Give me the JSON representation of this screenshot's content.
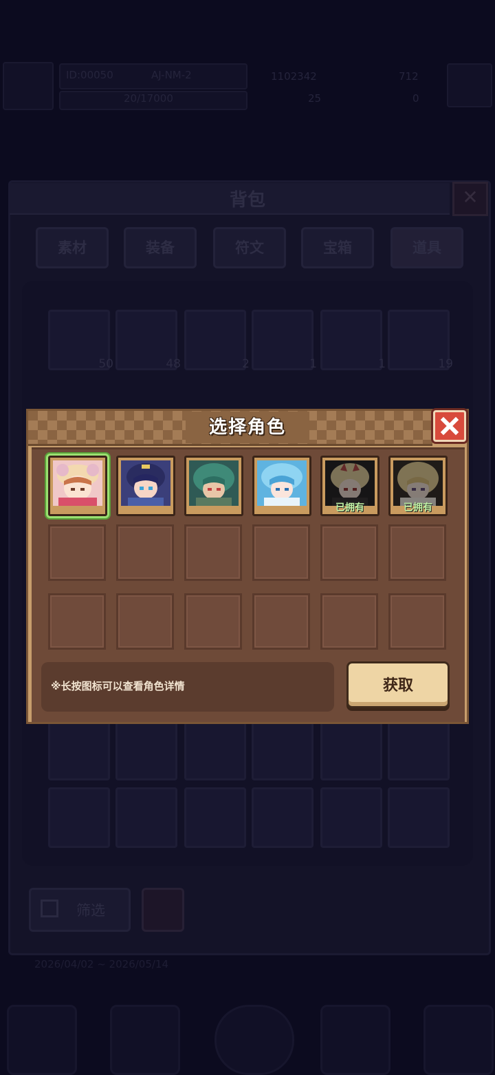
{
  "background": {
    "topbar": {
      "player_id_label": "ID:00050",
      "version_label": "AJ-NM-2",
      "gold_value": "1102342",
      "gem_value": "712",
      "stamina_value": "20/17000",
      "key_value": "25",
      "ticket_value": "0"
    },
    "bag_title": "背包",
    "tabs": [
      "素材",
      "装备",
      "符文",
      "宝箱",
      "道具"
    ],
    "item_counts": [
      "50",
      "48",
      "2",
      "1",
      "1",
      "19"
    ],
    "filter_label": "筛选",
    "date_range": "2026/04/02 ~ 2026/05/14"
  },
  "modal": {
    "title": "选择角色",
    "close_icon": "close-icon",
    "characters": [
      {
        "name": "character-1",
        "owned": false,
        "selected": true,
        "owned_label": ""
      },
      {
        "name": "character-2",
        "owned": false,
        "selected": false,
        "owned_label": ""
      },
      {
        "name": "character-3",
        "owned": false,
        "selected": false,
        "owned_label": ""
      },
      {
        "name": "character-4",
        "owned": false,
        "selected": false,
        "owned_label": ""
      },
      {
        "name": "character-5",
        "owned": true,
        "selected": false,
        "owned_label": "已拥有"
      },
      {
        "name": "character-6",
        "owned": true,
        "selected": false,
        "owned_label": "已拥有"
      }
    ],
    "hint": "※长按图标可以查看角色详情",
    "get_button": "获取"
  },
  "colors": {
    "modal_frame": "#c79e6d",
    "modal_body": "#6e4a38",
    "selected_outline": "#9be071",
    "close_red": "#d84a3c",
    "owned_text": "#bff0a4"
  }
}
